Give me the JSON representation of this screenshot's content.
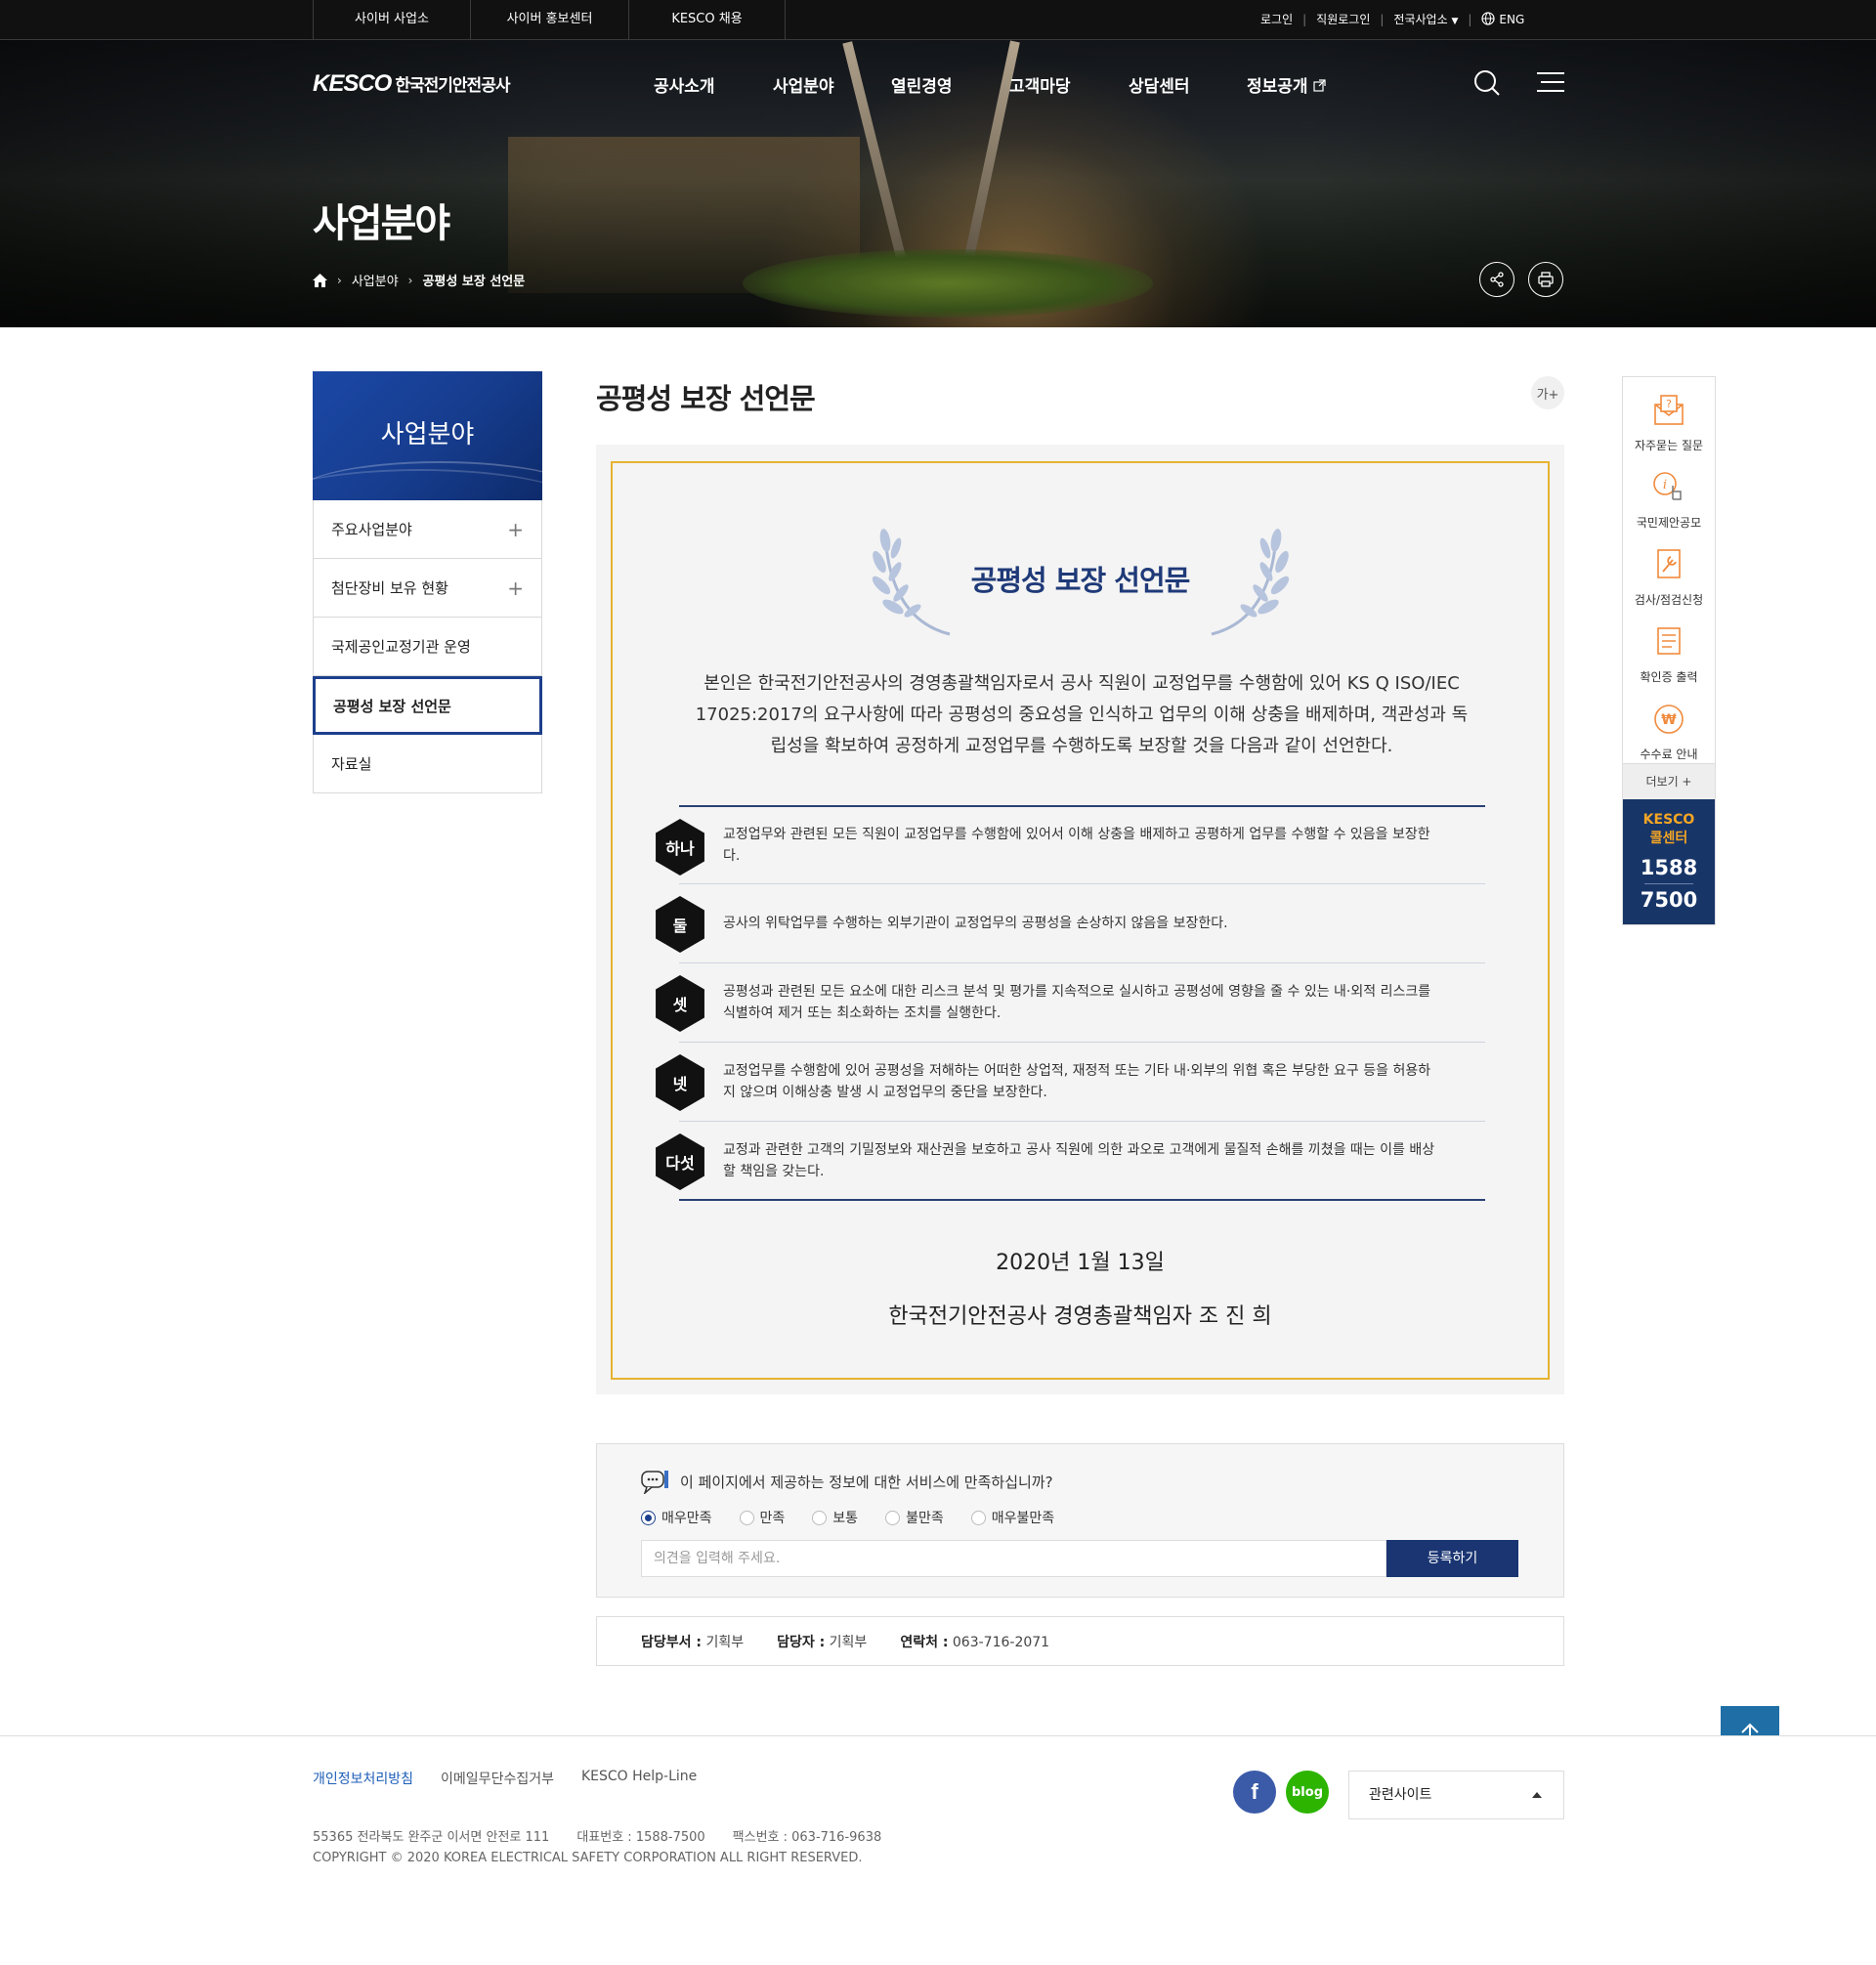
{
  "topbar": {
    "links": [
      "사이버 사업소",
      "사이버 홍보센터",
      "KESCO 채용"
    ],
    "login": "로그인",
    "staff_login": "직원로그인",
    "offices": "전국사업소",
    "lang": "ENG"
  },
  "header": {
    "logo_en": "KESCO",
    "logo_ko": "한국전기안전공사",
    "menu": [
      "공사소개",
      "사업분야",
      "열린경영",
      "고객마당",
      "상담센터",
      "정보공개"
    ],
    "page_title": "사업분야",
    "breadcrumb": [
      "사업분야",
      "공평성 보장 선언문"
    ]
  },
  "lnb": {
    "title": "사업분야",
    "items": [
      {
        "label": "주요사업분야",
        "expandable": true
      },
      {
        "label": "첨단장비 보유 현황",
        "expandable": true
      },
      {
        "label": "국제공인교정기관 운영",
        "expandable": false
      },
      {
        "label": "공평성 보장 선언문",
        "expandable": false,
        "active": true
      },
      {
        "label": "자료실",
        "expandable": false
      }
    ]
  },
  "content": {
    "title": "공평성 보장 선언문",
    "font_button": "가+",
    "declaration": {
      "heading": "공평성 보장 선언문",
      "intro": "본인은 한국전기안전공사의 경영총괄책임자로서 공사 직원이 교정업무를 수행함에 있어 KS Q ISO/IEC 17025:2017의 요구사항에 따라 공평성의 중요성을 인식하고 업무의 이해 상충을 배제하며, 객관성과 독립성을 확보하여 공정하게 교정업무를 수행하도록 보장할 것을 다음과 같이 선언한다.",
      "items": [
        {
          "badge": "하나",
          "text": "교정업무와 관련된 모든 직원이 교정업무를 수행함에 있어서 이해 상충을 배제하고 공평하게 업무를 수행할 수 있음을 보장한다."
        },
        {
          "badge": "둘",
          "text": "공사의 위탁업무를 수행하는 외부기관이 교정업무의 공평성을 손상하지 않음을 보장한다."
        },
        {
          "badge": "셋",
          "text": "공평성과 관련된 모든 요소에 대한 리스크 분석 및 평가를 지속적으로 실시하고 공평성에 영향을 줄 수 있는 내·외적 리스크를 식별하여 제거 또는 최소화하는 조치를 실행한다."
        },
        {
          "badge": "넷",
          "text": "교정업무를 수행함에 있어 공평성을 저해하는 어떠한 상업적, 재정적 또는 기타 내·외부의 위협 혹은 부당한 요구 등을 허용하지 않으며 이해상충 발생 시 교정업무의 중단을 보장한다."
        },
        {
          "badge": "다섯",
          "text": "교정과 관련한 고객의 기밀정보와 재산권을 보호하고 공사 직원에 의한 과오로 고객에게 물질적 손해를 끼쳤을 때는 이를 배상할 책임을 갖는다."
        }
      ],
      "date": "2020년 1월 13일",
      "signature": "한국전기안전공사 경영총괄책임자 조 진 희"
    }
  },
  "survey": {
    "question": "이 페이지에서 제공하는 정보에 대한 서비스에 만족하십니까?",
    "options": [
      "매우만족",
      "만족",
      "보통",
      "불만족",
      "매우불만족"
    ],
    "selected": "매우만족",
    "placeholder": "의견을 입력해 주세요.",
    "submit": "등록하기"
  },
  "manager": {
    "dept_label": "담당부서 :",
    "dept": "기획부",
    "person_label": "담당자 :",
    "person": "기획부",
    "contact_label": "연락처 :",
    "contact": "063-716-2071"
  },
  "quick": {
    "items": [
      "자주묻는 질문",
      "국민제안공모",
      "검사/점검신청",
      "확인증 출력",
      "수수료 안내"
    ],
    "more": "더보기 +",
    "call_title_1": "KESCO",
    "call_title_2": "콜센터",
    "call_num_1": "1588",
    "call_num_2": "7500"
  },
  "footer": {
    "links": [
      "개인정보처리방침",
      "이메일무단수집거부",
      "KESCO Help-Line"
    ],
    "address": "55365 전라북도 완주군 이서면 안전로 111",
    "tel": "대표번호 : 1588-7500",
    "fax": "팩스번호 : 063-716-9638",
    "copyright": "COPYRIGHT © 2020 KOREA ELECTRICAL SAFETY CORPORATION ALL RIGHT RESERVED.",
    "blog": "blog",
    "related": "관련사이트"
  },
  "colors": {
    "brand_navy": "#1a3572",
    "accent_gold": "#e6b332",
    "call_orange": "#f5a623"
  }
}
